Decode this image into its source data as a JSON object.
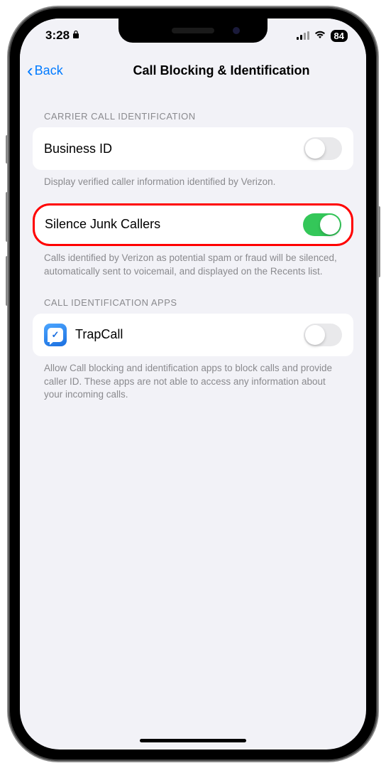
{
  "status_bar": {
    "time": "3:28",
    "battery_percent": "84"
  },
  "nav": {
    "back_label": "Back",
    "title": "Call Blocking & Identification"
  },
  "sections": {
    "carrier": {
      "header": "CARRIER CALL IDENTIFICATION",
      "business_id": {
        "label": "Business ID",
        "on": false
      },
      "business_id_footer": "Display verified caller information identified by Verizon.",
      "silence_junk": {
        "label": "Silence Junk Callers",
        "on": true
      },
      "silence_junk_footer": "Calls identified by Verizon as potential spam or fraud will be silenced, automatically sent to voicemail, and displayed on the Recents list."
    },
    "apps": {
      "header": "CALL IDENTIFICATION APPS",
      "trapcall": {
        "label": "TrapCall",
        "on": false
      },
      "apps_footer": "Allow Call blocking and identification apps to block calls and provide caller ID. These apps are not able to access any information about your incoming calls."
    }
  }
}
